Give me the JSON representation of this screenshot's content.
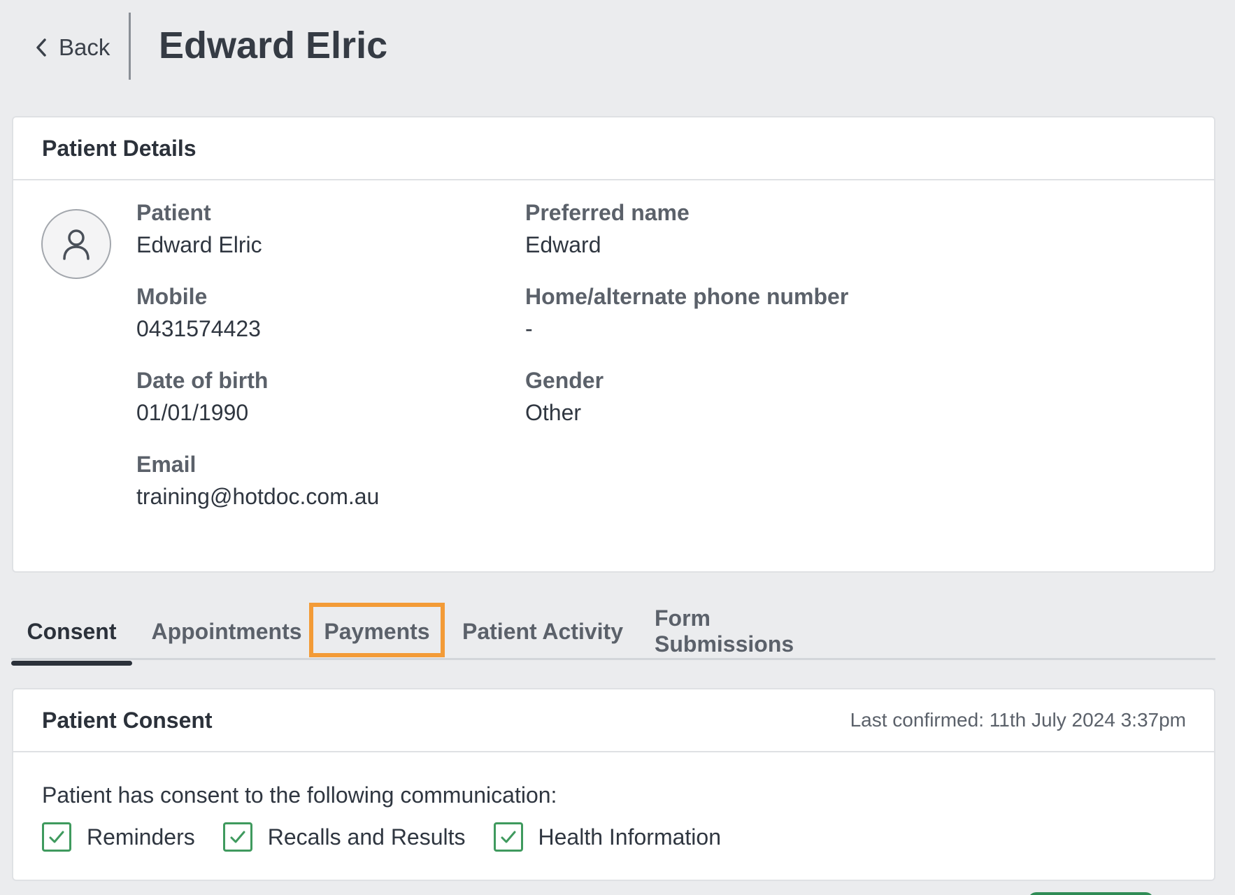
{
  "header": {
    "back_label": "Back",
    "title": "Edward Elric"
  },
  "details": {
    "title": "Patient Details",
    "avatar_icon": "person-outline-icon",
    "fields": {
      "patient": {
        "label": "Patient",
        "value": "Edward Elric"
      },
      "preferred": {
        "label": "Preferred name",
        "value": "Edward"
      },
      "mobile": {
        "label": "Mobile",
        "value": "0431574423"
      },
      "home_phone": {
        "label": "Home/alternate phone number",
        "value": "-"
      },
      "dob": {
        "label": "Date of birth",
        "value": "01/01/1990"
      },
      "gender": {
        "label": "Gender",
        "value": "Other"
      },
      "email": {
        "label": "Email",
        "value": "training@hotdoc.com.au"
      }
    }
  },
  "tabs": [
    {
      "label": "Consent",
      "active": true
    },
    {
      "label": "Appointments",
      "active": false
    },
    {
      "label": "Payments",
      "active": false,
      "highlighted": true
    },
    {
      "label": "Patient Activity",
      "active": false
    },
    {
      "label": "Form Submissions",
      "active": false
    }
  ],
  "consent": {
    "title": "Patient Consent",
    "last_confirmed": "Last confirmed: 11th July 2024 3:37pm",
    "intro": "Patient has consent to the following communication:",
    "items": [
      {
        "label": "Reminders",
        "checked": true
      },
      {
        "label": "Recalls and Results",
        "checked": true
      },
      {
        "label": "Health Information",
        "checked": true
      }
    ]
  },
  "colors": {
    "background": "#ebecee",
    "highlight": "#f39b37",
    "check_green": "#3f9a5e"
  }
}
